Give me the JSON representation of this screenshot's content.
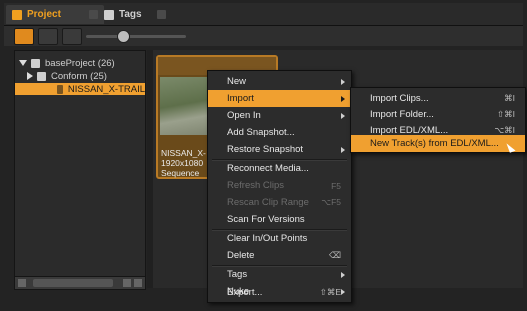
{
  "tabs": [
    {
      "label": "Project",
      "active": true
    },
    {
      "label": "Tags",
      "active": false
    }
  ],
  "tree": {
    "items": [
      {
        "label": "baseProject (26)",
        "expanded": true
      },
      {
        "label": "Conform (25)",
        "expanded": false
      },
      {
        "label": "NISSAN_X-TRAIL",
        "selected": true
      }
    ]
  },
  "clip": {
    "name": "NISSAN_X-",
    "resolution": "1920x1080",
    "type": "Sequence"
  },
  "context_menu": {
    "items": [
      {
        "label": "New",
        "submenu": true
      },
      {
        "label": "Import",
        "submenu": true,
        "highlighted": true
      },
      {
        "label": "Open In",
        "submenu": true
      },
      {
        "label": "Add Snapshot..."
      },
      {
        "label": "Restore Snapshot",
        "submenu": true
      },
      {
        "label": "Reconnect Media..."
      },
      {
        "label": "Refresh Clips",
        "shortcut": "F5",
        "disabled": true
      },
      {
        "label": "Rescan Clip Range",
        "shortcut": "⌥F5",
        "disabled": true
      },
      {
        "label": "Scan For Versions"
      },
      {
        "label": "Clear In/Out Points"
      },
      {
        "label": "Delete",
        "shortcut": "⌫"
      },
      {
        "label": "Tags",
        "submenu": true
      },
      {
        "label": "Nuke",
        "submenu": true
      },
      {
        "label": "Export...",
        "shortcut": "⇧⌘E"
      }
    ]
  },
  "import_submenu": {
    "items": [
      {
        "label": "Import Clips...",
        "shortcut": "⌘I"
      },
      {
        "label": "Import Folder...",
        "shortcut": "⇧⌘I"
      },
      {
        "label": "Import EDL/XML...",
        "shortcut": "⌥⌘I"
      },
      {
        "label": "New Track(s) from EDL/XML...",
        "highlighted": true
      }
    ]
  },
  "colors": {
    "accent": "#f0a030",
    "background": "#232323"
  }
}
